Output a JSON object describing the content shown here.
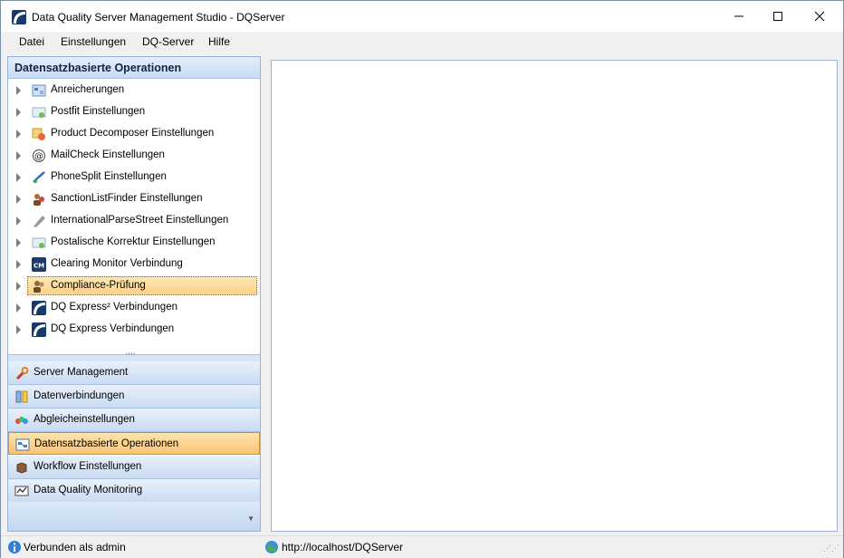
{
  "window": {
    "title": "Data Quality Server Management Studio - DQServer"
  },
  "menu": [
    "Datei",
    "Einstellungen",
    "DQ-Server",
    "Hilfe"
  ],
  "panel": {
    "header": "Datensatzbasierte Operationen",
    "tree": [
      {
        "label": "Anreicherungen",
        "icon": "enrichment-icon"
      },
      {
        "label": "Postfit Einstellungen",
        "icon": "postfit-icon"
      },
      {
        "label": "Product Decomposer Einstellungen",
        "icon": "product-decomposer-icon"
      },
      {
        "label": "MailCheck Einstellungen",
        "icon": "at-sign-icon"
      },
      {
        "label": "PhoneSplit Einstellungen",
        "icon": "phone-split-icon"
      },
      {
        "label": "SanctionListFinder Einstellungen",
        "icon": "sanction-list-icon"
      },
      {
        "label": "InternationalParseStreet Einstellungen",
        "icon": "parse-street-icon"
      },
      {
        "label": "Postalische Korrektur Einstellungen",
        "icon": "postal-correction-icon"
      },
      {
        "label": "Clearing Monitor Verbindung",
        "icon": "clearing-monitor-icon"
      },
      {
        "label": "Compliance-Prüfung",
        "icon": "compliance-icon",
        "selected": true
      },
      {
        "label": "DQ Express² Verbindungen",
        "icon": "dq-express-icon"
      },
      {
        "label": "DQ Express Verbindungen",
        "icon": "dq-express-icon"
      }
    ],
    "nav": [
      {
        "label": "Server Management",
        "icon": "wrench-icon"
      },
      {
        "label": "Datenverbindungen",
        "icon": "data-connections-icon"
      },
      {
        "label": "Abgleicheinstellungen",
        "icon": "matching-icon"
      },
      {
        "label": "Datensatzbasierte Operationen",
        "icon": "record-operations-icon",
        "active": true
      },
      {
        "label": "Workflow Einstellungen",
        "icon": "workflow-icon"
      },
      {
        "label": "Data Quality Monitoring",
        "icon": "monitoring-icon"
      }
    ]
  },
  "status": {
    "left": "Verbunden als admin",
    "url": "http://localhost/DQServer"
  }
}
